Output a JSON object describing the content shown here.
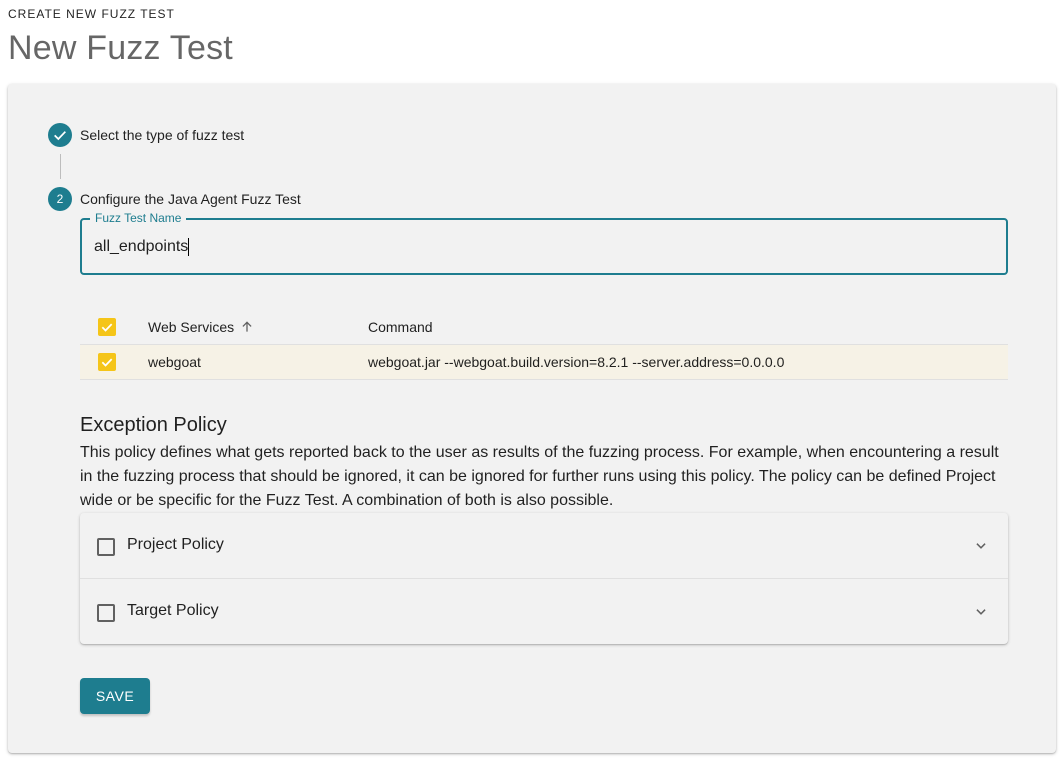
{
  "header": {
    "overline": "CREATE NEW FUZZ TEST",
    "title": "New Fuzz Test"
  },
  "stepper": {
    "steps": [
      {
        "label": "Select the type of fuzz test",
        "state": "completed",
        "icon": "check-icon"
      },
      {
        "label": "Configure the Java Agent Fuzz Test",
        "state": "active",
        "number": "2"
      }
    ]
  },
  "form": {
    "name_field": {
      "label": "Fuzz Test Name",
      "value": "all_endpoints"
    }
  },
  "table": {
    "columns": [
      "Web Services",
      "Command"
    ],
    "sort": {
      "column": "Web Services",
      "direction": "ascending",
      "icon": "arrow-up-icon"
    },
    "rows": [
      {
        "service": "webgoat",
        "command": "webgoat.jar --webgoat.build.version=8.2.1 --server.address=0.0.0.0",
        "selected": true
      }
    ],
    "select_all_checked": true
  },
  "exception_policy": {
    "title": "Exception Policy",
    "description": "This policy defines what gets reported back to the user as results of the fuzzing process. For example, when encountering a result in the fuzzing process that should be ignored, it can be ignored for further runs using this policy. The policy can be defined Project wide or be specific for the Fuzz Test. A combination of both is also possible.",
    "items": [
      {
        "label": "Project Policy",
        "checked": false
      },
      {
        "label": "Target Policy",
        "checked": false
      }
    ]
  },
  "actions": {
    "save_label": "Save"
  },
  "colors": {
    "primary": "#1e7d8f",
    "checkbox_checked": "#f5c518",
    "selected_row": "#f6f2e6",
    "card_bg": "#f2f2f2"
  }
}
